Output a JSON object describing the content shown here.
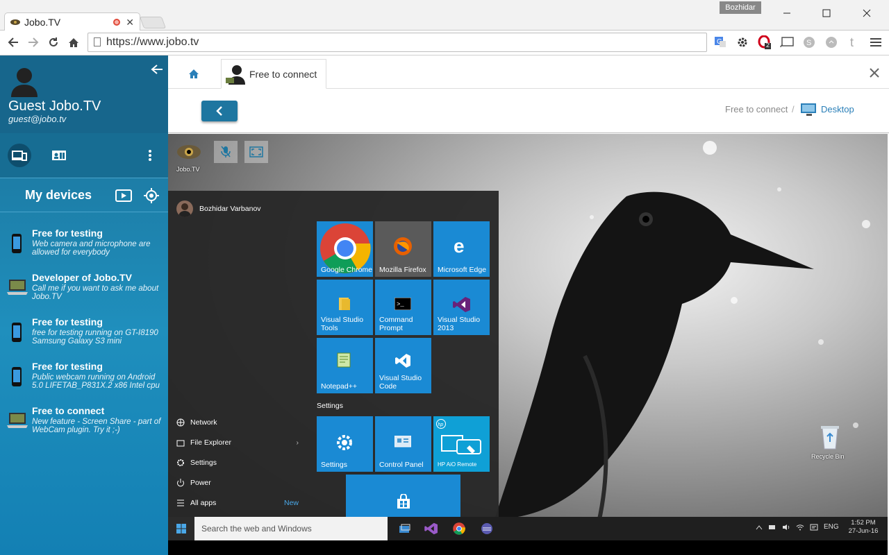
{
  "browser": {
    "tab_title": "Jobo.TV",
    "user_badge": "Bozhidar",
    "url": "https://www.jobo.tv",
    "extension_badge": "2"
  },
  "sidebar": {
    "user_name": "Guest Jobo.TV",
    "user_email": "guest@jobo.tv",
    "section_title": "My devices",
    "devices": [
      {
        "title": "Free for testing",
        "desc": "Web camera and microphone are allowed for everybody",
        "type": "phone"
      },
      {
        "title": "Developer of Jobo.TV",
        "desc": "Call me if you want to ask me about Jobo.TV",
        "type": "laptop"
      },
      {
        "title": "Free for testing",
        "desc": "free for testing running on GT-I8190 Samsung Galaxy S3 mini",
        "type": "phone"
      },
      {
        "title": "Free for testing",
        "desc": "Public webcam running on Android 5.0 LIFETAB_P831X.2 x86 Intel cpu",
        "type": "phone"
      },
      {
        "title": "Free to connect",
        "desc": "New feature - Screen Share - part of WebCam plugin. Try it ;-)",
        "type": "laptop"
      }
    ]
  },
  "content": {
    "tab_label": "Free to connect",
    "breadcrumb_1": "Free to connect",
    "breadcrumb_sep": "/",
    "breadcrumb_2": "Desktop"
  },
  "remote": {
    "desktop_icon_label": "Jobo.TV",
    "recycle_label": "Recycle Bin",
    "start_user": "Bozhidar Varbanov",
    "tiles": [
      {
        "label": "Google Chrome"
      },
      {
        "label": "Mozilla Firefox"
      },
      {
        "label": "Microsoft Edge"
      },
      {
        "label": "Visual Studio Tools"
      },
      {
        "label": "Command Prompt"
      },
      {
        "label": "Visual Studio 2013"
      },
      {
        "label": "Notepad++"
      },
      {
        "label": "Visual Studio Code"
      },
      {
        "label": "Settings"
      },
      {
        "label": "Control Panel"
      },
      {
        "label": "HP AiO Remote"
      }
    ],
    "settings_group": "Settings",
    "menu": {
      "network": "Network",
      "file_explorer": "File Explorer",
      "settings": "Settings",
      "power": "Power",
      "all_apps": "All apps",
      "new_badge": "New"
    },
    "search_placeholder": "Search the web and Windows",
    "tray_lang": "ENG",
    "clock_time": "1:52 PM",
    "clock_date": "27-Jun-16"
  },
  "colors": {
    "sidebar_blue": "#1b7aa6",
    "accent": "#1e76a0",
    "tile_blue": "#1a8ad4"
  }
}
